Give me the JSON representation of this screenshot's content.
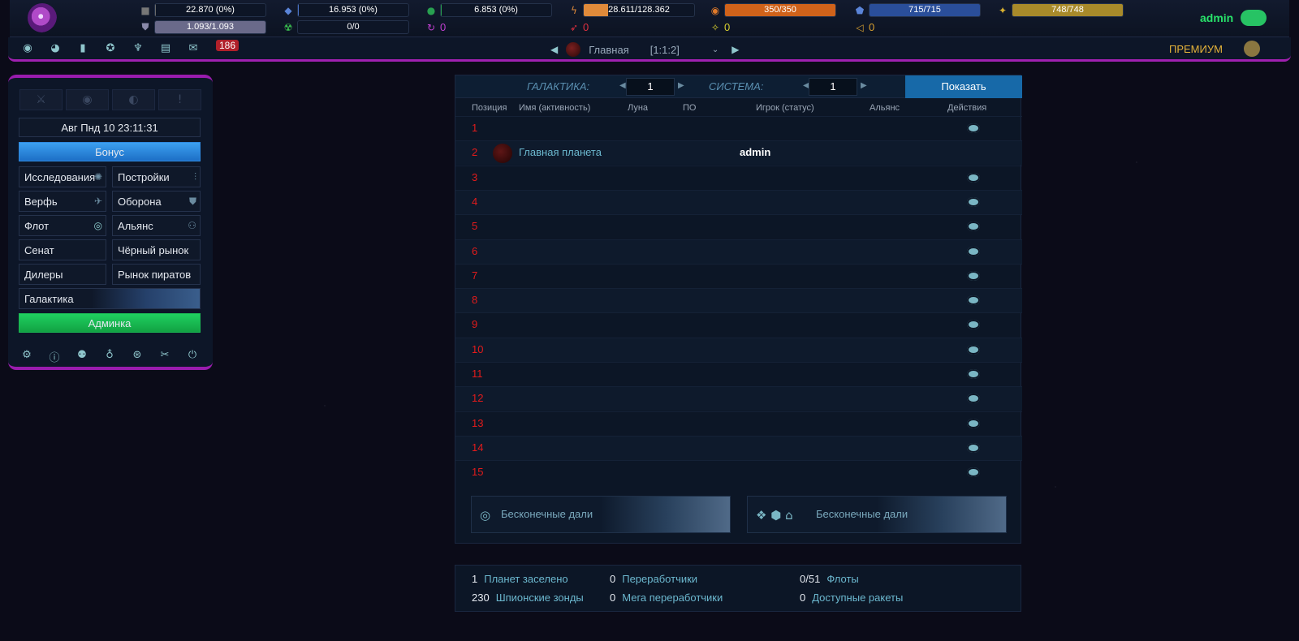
{
  "topbar": {
    "resources": [
      {
        "icon": "metal-icon",
        "value": "22.870 (0%)",
        "color": "#6a6a6a",
        "fill": 0.01
      },
      {
        "icon": "crystal-icon",
        "value": "16.953 (0%)",
        "color": "#4a74c8",
        "fill": 0.01
      },
      {
        "icon": "deuterium-icon",
        "value": "6.853 (0%)",
        "color": "#28a050",
        "fill": 0.01
      },
      {
        "icon": "energy-icon",
        "value": "28.611/128.362",
        "color": "#e08a3a",
        "fill": 0.22
      },
      {
        "icon": "darkmatter-icon",
        "value": "350/350",
        "color": "#d0621a",
        "fill": 1.0
      },
      {
        "icon": "crystal-cap-icon",
        "value": "715/715",
        "color": "#2a4e9a",
        "fill": 1.0
      },
      {
        "icon": "gold-icon",
        "value": "748/748",
        "color": "#a88a2a",
        "fill": 1.0
      }
    ],
    "row2": [
      {
        "icon": "shield-icon",
        "value": "1.093/1.093",
        "color": "#6a6a8a",
        "fill": 1.0
      },
      {
        "icon": "radiation-icon",
        "value": "0/0",
        "color": "#2a8a3a",
        "fill": 0
      }
    ],
    "counters": [
      {
        "icon": "recycle-icon",
        "value": "0",
        "color": "#c040d0"
      },
      {
        "icon": "missile-icon",
        "value": "0",
        "color": "#e03040"
      },
      {
        "icon": "star-icon",
        "value": "0",
        "color": "#d8d030"
      },
      {
        "icon": "trophy-icon",
        "value": "0",
        "color": "#d8a030"
      }
    ],
    "username": "admin"
  },
  "navbar": {
    "message_count": "186",
    "planet_name": "Главная",
    "planet_coords": "[1:1:2]",
    "premium": "ПРЕМИУМ"
  },
  "sidebar": {
    "server_time": "Авг Пнд 10 23:11:31",
    "bonus": "Бонус",
    "menu": [
      [
        "Исследования",
        "Постройки"
      ],
      [
        "Верфь",
        "Оборона"
      ],
      [
        "Флот",
        "Альянс"
      ],
      [
        "Сенат",
        "Чёрный рынок"
      ],
      [
        "Дилеры",
        "Рынок пиратов"
      ]
    ],
    "galaxy": "Галактика",
    "admin": "Админка"
  },
  "galaxy": {
    "galaxy_label": "ГАЛАКТИКА:",
    "galaxy_value": "1",
    "system_label": "СИСТЕМА:",
    "system_value": "1",
    "show_button": "Показать",
    "columns": [
      "Позиция",
      "Имя (активность)",
      "Луна",
      "ПО",
      "Игрок (статус)",
      "Альянс",
      "Действия"
    ],
    "rows": [
      {
        "pos": "1",
        "planet": "",
        "player": ""
      },
      {
        "pos": "2",
        "planet": "Главная планета",
        "player": "admin"
      },
      {
        "pos": "3",
        "planet": "",
        "player": ""
      },
      {
        "pos": "4",
        "planet": "",
        "player": ""
      },
      {
        "pos": "5",
        "planet": "",
        "player": ""
      },
      {
        "pos": "6",
        "planet": "",
        "player": ""
      },
      {
        "pos": "7",
        "planet": "",
        "player": ""
      },
      {
        "pos": "8",
        "planet": "",
        "player": ""
      },
      {
        "pos": "9",
        "planet": "",
        "player": ""
      },
      {
        "pos": "10",
        "planet": "",
        "player": ""
      },
      {
        "pos": "11",
        "planet": "",
        "player": ""
      },
      {
        "pos": "12",
        "planet": "",
        "player": ""
      },
      {
        "pos": "13",
        "planet": "",
        "player": ""
      },
      {
        "pos": "14",
        "planet": "",
        "player": ""
      },
      {
        "pos": "15",
        "planet": "",
        "player": ""
      }
    ],
    "banner_left": "Бесконечные дали",
    "banner_right": "Бесконечные дали"
  },
  "stats": {
    "planets_value": "1",
    "planets_label": "Планет заселено",
    "recyclers_value": "0",
    "recyclers_label": "Переработчики",
    "fleets_value": "0/51",
    "fleets_label": "Флоты",
    "probes_value": "230",
    "probes_label": "Шпионские зонды",
    "mega_value": "0",
    "mega_label": "Мега переработчики",
    "missiles_value": "0",
    "missiles_label": "Доступные ракеты"
  }
}
